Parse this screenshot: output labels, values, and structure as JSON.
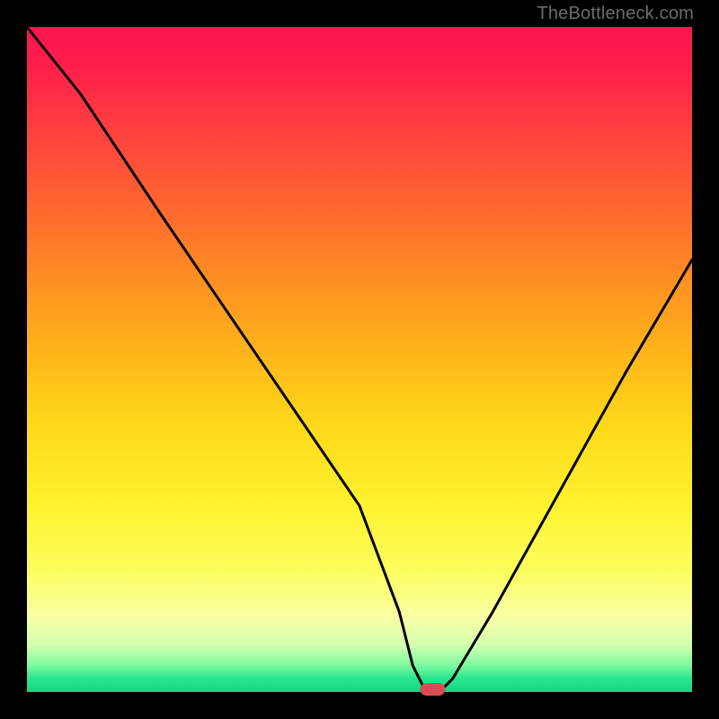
{
  "watermark": "TheBottleneck.com",
  "chart_data": {
    "type": "line",
    "title": "",
    "xlabel": "",
    "ylabel": "",
    "xlim": [
      0,
      100
    ],
    "ylim": [
      0,
      100
    ],
    "background_gradient": {
      "top_color": "#ff1450",
      "mid_color": "#ffe028",
      "bottom_color": "#16d482"
    },
    "series": [
      {
        "name": "bottleneck-curve",
        "x": [
          0,
          8,
          20,
          35,
          50,
          56,
          58,
          60,
          62,
          64,
          70,
          80,
          90,
          100
        ],
        "values": [
          100,
          90,
          72,
          50,
          28,
          12,
          4,
          0,
          0,
          2,
          12,
          30,
          48,
          65
        ]
      }
    ],
    "marker": {
      "name": "optimal-point",
      "x": 61,
      "y": 0,
      "color": "#d84b55",
      "shape": "rounded-rect"
    }
  }
}
